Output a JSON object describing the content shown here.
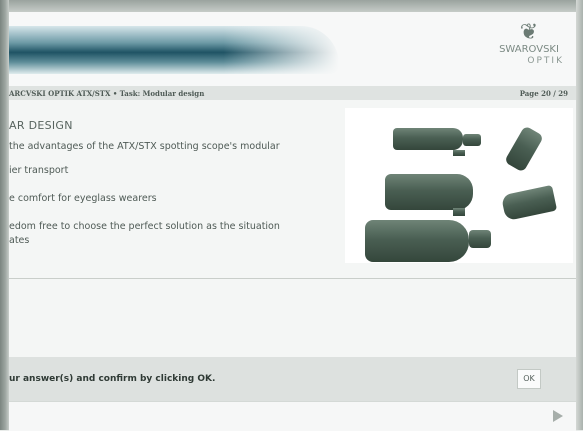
{
  "header": {
    "brand_line1": "SWAROVSKI",
    "brand_line2": "OPTIK",
    "swan_icon": "swan-logo-icon"
  },
  "breadcrumb": "ARCVSKI OPTIK ATX/STX • Task: Modular design",
  "page_number": "Page 20 / 29",
  "content": {
    "title": "AR DESIGN",
    "items": [
      "the advantages of the ATX/STX spotting scope's modular",
      "ier transport",
      "e comfort for eyeglass wearers",
      "edom free to choose the perfect solution as the situation\nates"
    ]
  },
  "footer": {
    "instruction": "ur answer(s) and confirm by clicking OK.",
    "ok_label": "OK",
    "next_icon": "next-arrow-icon"
  }
}
